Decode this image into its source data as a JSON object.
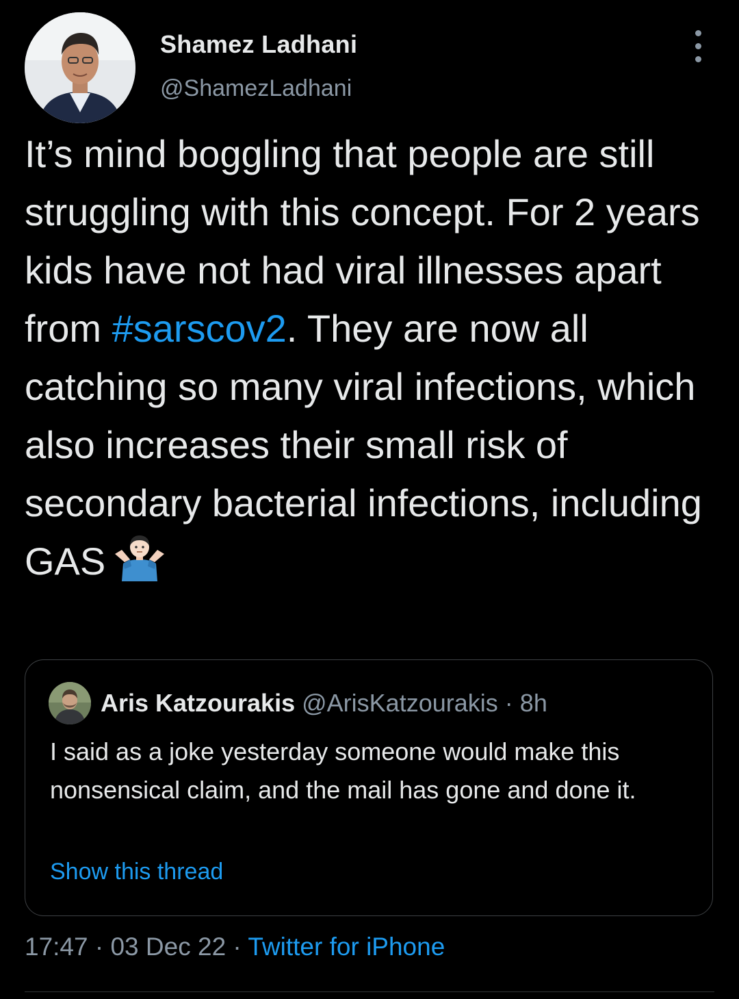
{
  "author": {
    "display_name": "Shamez Ladhani",
    "handle": "@ShamezLadhani"
  },
  "tweet": {
    "text_part1": "It’s mind boggling that people are still struggling with this concept. For 2 years kids have not had viral illnesses apart from ",
    "hashtag": "#sarscov2",
    "text_part2": ". They are now all catching so many viral infections, which also increases their small risk of secondary bacterial infections, including GAS",
    "emoji": "man-shrugging-emoji"
  },
  "quoted_tweet": {
    "display_name": "Aris Katzourakis",
    "handle": "@ArisKatzourakis",
    "separator": "·",
    "time": "8h",
    "text": "I said as a joke yesterday someone would make this nonsensical claim, and the mail has gone and done it.",
    "show_thread": "Show this thread"
  },
  "meta": {
    "time": "17:47",
    "separator1": " · ",
    "date": "03 Dec 22",
    "separator2": " · ",
    "source": "Twitter for iPhone"
  },
  "colors": {
    "background": "#000000",
    "text": "#e7e9ea",
    "secondary": "#8b98a5",
    "link": "#1d9bf0",
    "border": "#3e4144"
  }
}
